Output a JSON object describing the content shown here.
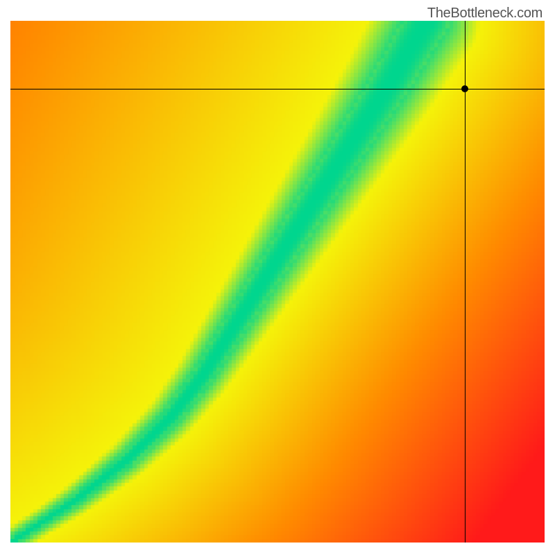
{
  "attribution": "TheBottleneck.com",
  "chart_data": {
    "type": "heatmap",
    "title": "",
    "xlabel": "",
    "ylabel": "",
    "xlim": [
      0,
      100
    ],
    "ylim": [
      0,
      100
    ],
    "crosshair": {
      "x": 85,
      "y": 87
    },
    "marker": {
      "x": 85,
      "y": 87
    },
    "ridge_path": [
      {
        "x": 0,
        "y": 0
      },
      {
        "x": 12,
        "y": 8
      },
      {
        "x": 22,
        "y": 16
      },
      {
        "x": 30,
        "y": 24
      },
      {
        "x": 36,
        "y": 32
      },
      {
        "x": 41,
        "y": 40
      },
      {
        "x": 46,
        "y": 48
      },
      {
        "x": 51,
        "y": 56
      },
      {
        "x": 56,
        "y": 64
      },
      {
        "x": 61,
        "y": 72
      },
      {
        "x": 66,
        "y": 80
      },
      {
        "x": 71,
        "y": 88
      },
      {
        "x": 75,
        "y": 95
      },
      {
        "x": 78,
        "y": 100
      }
    ],
    "ridge_green_halfwidth": 4.0,
    "ridge_yellow_halfwidth": 9.0,
    "colors": {
      "green": "#00d68f",
      "yellow": "#f5f30a",
      "orange": "#ff8c00",
      "red": "#ff1a1a"
    }
  }
}
